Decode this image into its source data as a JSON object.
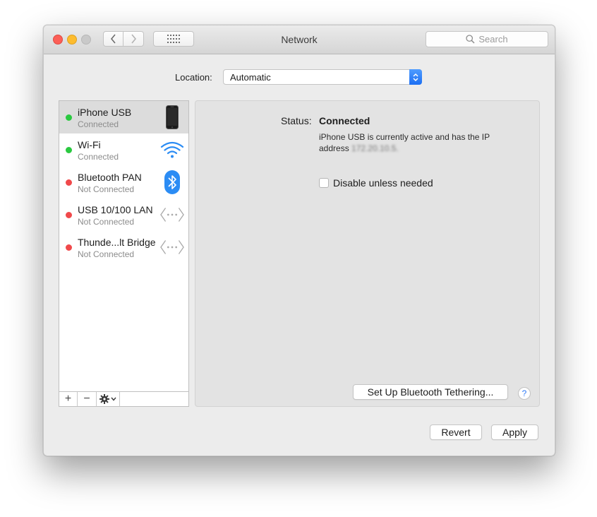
{
  "window": {
    "title": "Network"
  },
  "toolbar": {
    "search_placeholder": "Search"
  },
  "location": {
    "label": "Location:",
    "value": "Automatic"
  },
  "services": [
    {
      "name": "iPhone USB",
      "status": "Connected",
      "status_color": "#2ac940",
      "icon": "iphone-icon",
      "selected": true
    },
    {
      "name": "Wi-Fi",
      "status": "Connected",
      "status_color": "#2ac940",
      "icon": "wifi-icon"
    },
    {
      "name": "Bluetooth PAN",
      "status": "Not Connected",
      "status_color": "#f0494b",
      "icon": "bluetooth-icon"
    },
    {
      "name": "USB 10/100 LAN",
      "status": "Not Connected",
      "status_color": "#f0494b",
      "icon": "ethernet-icon"
    },
    {
      "name": "Thunde...lt Bridge",
      "status": "Not Connected",
      "status_color": "#f0494b",
      "icon": "ethernet-icon"
    }
  ],
  "sidebar_tools": {
    "add": "+",
    "remove": "−"
  },
  "detail": {
    "status_label": "Status:",
    "status_value": "Connected",
    "description": "iPhone USB is currently active and has the IP address",
    "ip_address": "172.20.10.5.",
    "disable_checkbox_label": "Disable unless needed",
    "disable_checked": false,
    "tethering_button": "Set Up Bluetooth Tethering...",
    "help": "?"
  },
  "footer": {
    "revert_label": "Revert",
    "apply_label": "Apply"
  },
  "colors": {
    "accent": "#1c6ff3",
    "close": "#fc5f57",
    "minimize": "#fdbc2e",
    "maximize": "#c9c9c9"
  }
}
